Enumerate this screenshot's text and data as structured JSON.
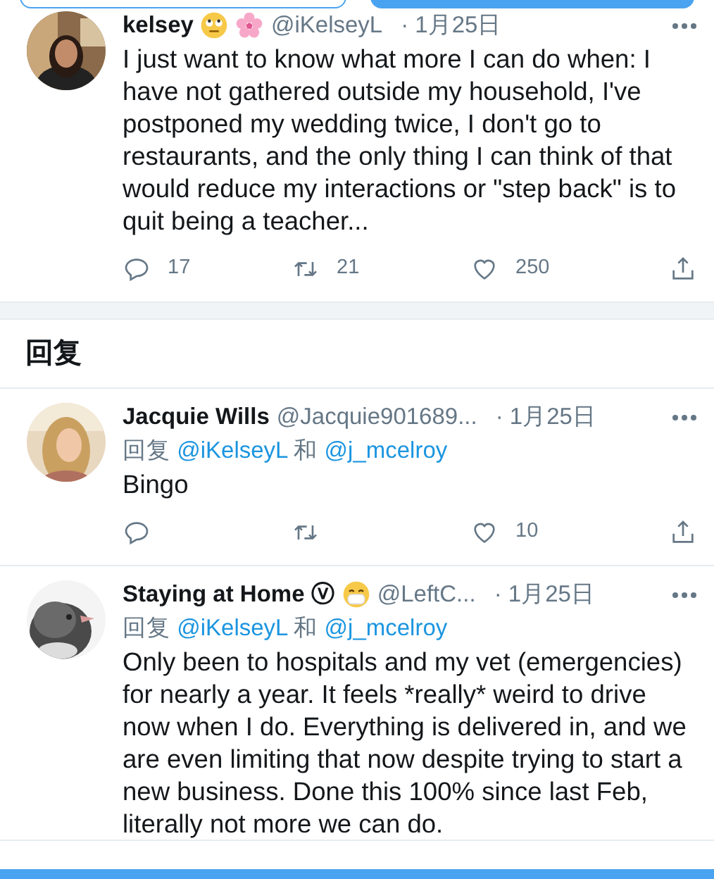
{
  "top_buttons": [
    {
      "kind": "outline"
    },
    {
      "kind": "filled"
    }
  ],
  "tweets": [
    {
      "name": "kelsey",
      "badges": [
        {
          "kind": "rolling-eyes"
        },
        {
          "kind": "blossom"
        }
      ],
      "handle": "@iKelseyL",
      "date": "· 1月25日",
      "avatar": {
        "kind": "picture"
      },
      "text": "I just want to know what more I can do when: I have not gathered outside my household, I've postponed my wedding twice, I don't go to restaurants, and the only thing I can think of that would reduce my interactions or \"step back\" is to quit being a teacher...",
      "actions": {
        "reply": "17",
        "retweet": "21",
        "like": "250"
      }
    },
    {
      "kind": "section-header",
      "text": "回复"
    },
    {
      "name": "Jacquie Wills",
      "handle": "@Jacquie901689...",
      "date": "· 1月25日",
      "avatar": {
        "kind": "picture"
      },
      "reply_to": {
        "prefix": "回复",
        "mentions": [
          "@iKelseyL",
          "@j_mcelroy"
        ],
        "joiner": "和"
      },
      "text": "Bingo",
      "actions": {
        "like": "10"
      }
    },
    {
      "name": "Staying at Home ⓥ",
      "badges": [
        {
          "kind": "mask-face"
        }
      ],
      "handle": "@LeftC...",
      "date": "· 1月25日",
      "avatar": {
        "kind": "picture"
      },
      "reply_to": {
        "prefix": "回复",
        "mentions": [
          "@iKelseyL",
          "@j_mcelroy"
        ],
        "joiner": "和"
      },
      "text": "Only been to hospitals and my vet (emergencies) for nearly a year. It feels *really* weird to drive now when I do. Everything is delivered in, and we are even limiting that now despite trying to start a new business. Done this 100% since last Feb, literally not more we can do."
    }
  ],
  "bottom_bar": {
    "kind": "filled"
  }
}
